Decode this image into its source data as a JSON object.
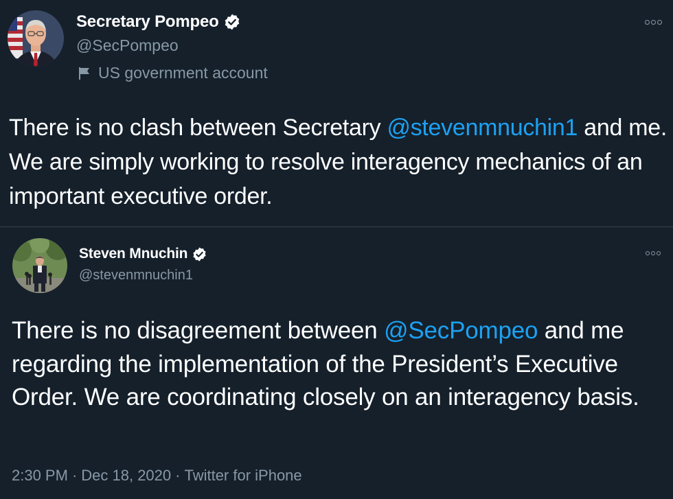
{
  "tweet1": {
    "author_name": "Secretary Pompeo",
    "handle": "@SecPompeo",
    "account_label": "US government account",
    "text_before": "There is no clash between Secretary ",
    "mention": "@stevenmnuchin1",
    "text_after": " and me. We are simply working to resolve interagency mechanics of an important executive order.",
    "icons": [
      "verified-badge-icon",
      "flag-icon",
      "more-options-icon"
    ]
  },
  "tweet2": {
    "author_name": "Steven Mnuchin",
    "handle": "@stevenmnuchin1",
    "text_before": "There is no disagreement between ",
    "mention": "@SecPompeo",
    "text_after": " and me regarding the implementation of the President’s Executive Order. We are coordinating closely on an interagency basis.",
    "time": "2:30 PM",
    "date": "Dec 18, 2020",
    "source": "Twitter for iPhone",
    "separator": "·",
    "icons": [
      "verified-badge-icon",
      "more-options-icon"
    ]
  },
  "colors": {
    "background": "#15202b",
    "text": "#ffffff",
    "secondary_text": "#8899a6",
    "link": "#1da1f2",
    "divider": "#38444d"
  }
}
